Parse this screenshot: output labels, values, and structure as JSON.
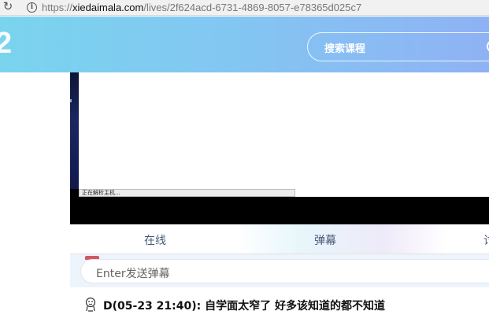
{
  "browser": {
    "url_scheme": "https://",
    "url_host": "xiedaimala.com",
    "url_path": "/lives/2f624acd-6731-4869-8057-e78365d025c7"
  },
  "header": {
    "logo_fragment": "2",
    "search_placeholder": "搜索课程"
  },
  "player": {
    "status_text": "正在解析主机..."
  },
  "tabs": [
    {
      "label": "在线"
    },
    {
      "label": "弹幕"
    },
    {
      "label": "讨"
    }
  ],
  "danmu": {
    "placeholder": "Enter发送弹幕"
  },
  "messages": [
    {
      "text": "D(05-23 21:40): 自学面太窄了 好多该知道的都不知道"
    }
  ]
}
